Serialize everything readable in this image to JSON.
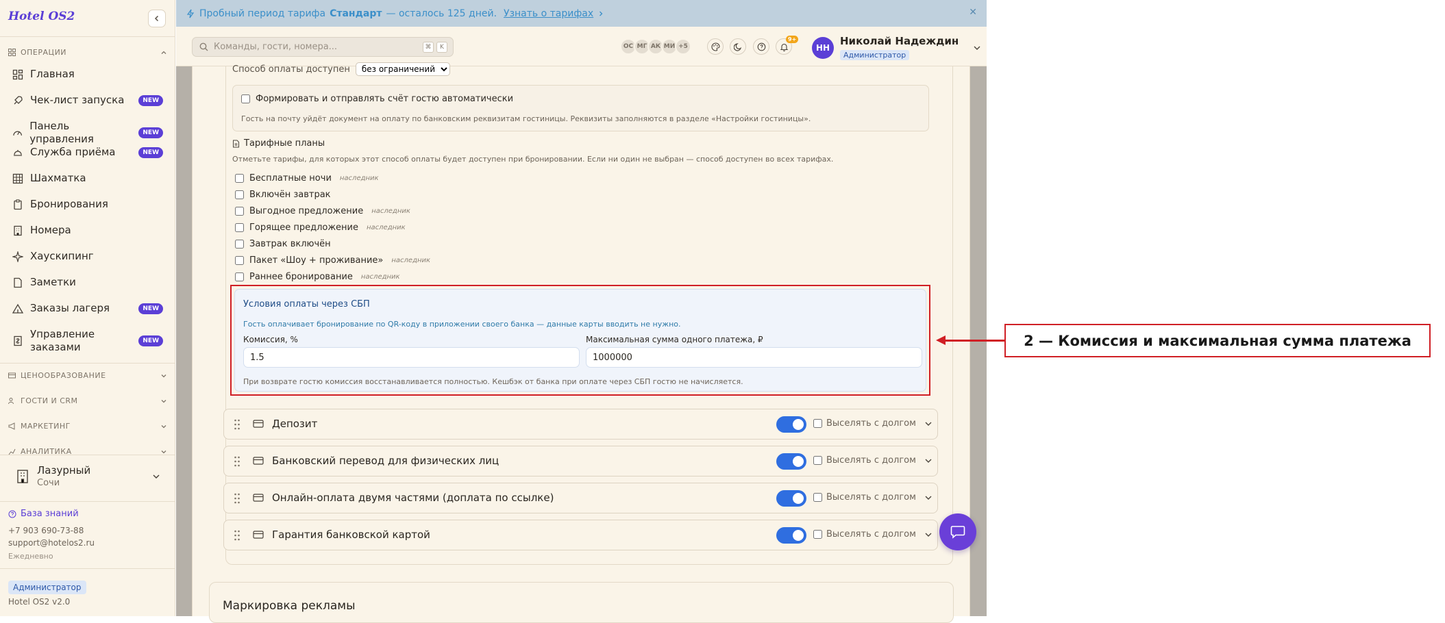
{
  "app": {
    "logo": "Hotel OS2"
  },
  "banner": {
    "prefix": "Пробный период тарифа",
    "plan": "Стандарт",
    "suffix": "— осталось 125 дней.",
    "link": "Узнать о тарифах"
  },
  "sidebar": {
    "operations_title": "ОПЕРАЦИИ",
    "items": [
      {
        "label": "Главная",
        "icon": "dashboard-icon",
        "badge": ""
      },
      {
        "label": "Чек-лист запуска",
        "icon": "rocket-icon",
        "badge": "NEW"
      },
      {
        "label": "Панель управления",
        "icon": "gauge-icon",
        "badge": "NEW"
      },
      {
        "label": "Служба приёма",
        "icon": "bell-desk-icon",
        "badge": "NEW"
      },
      {
        "label": "Шахматка",
        "icon": "grid-icon",
        "badge": ""
      },
      {
        "label": "Бронирования",
        "icon": "clipboard-icon",
        "badge": ""
      },
      {
        "label": "Номера",
        "icon": "building-icon",
        "badge": ""
      },
      {
        "label": "Хаускипинг",
        "icon": "sparkle-icon",
        "badge": ""
      },
      {
        "label": "Заметки",
        "icon": "note-icon",
        "badge": ""
      },
      {
        "label": "Заказы лагеря",
        "icon": "tent-icon",
        "badge": "NEW"
      },
      {
        "label": "Управление заказами",
        "icon": "receipt-icon",
        "badge": "NEW"
      }
    ],
    "sections": [
      "ЦЕНООБРАЗОВАНИЕ",
      "ГОСТИ И CRM",
      "МАРКЕТИНГ",
      "АНАЛИТИКА"
    ],
    "hotel": {
      "name": "Лазурный",
      "city": "Сочи"
    },
    "knowledge": "База знаний",
    "phone": "+7 903 690-73-88",
    "email": "support@hotelos2.ru",
    "hours": "Ежедневно",
    "role": "Администратор",
    "version": "Hotel OS2 v2.0"
  },
  "topbar": {
    "search_placeholder": "Команды, гости, номера...",
    "kbd1": "⌘",
    "kbd2": "K",
    "avatars": [
      "ОС",
      "МГ",
      "АК",
      "МИ",
      "+5"
    ],
    "notif_count": "9+",
    "user_initials": "НН",
    "user_name": "Николай Надеждин",
    "user_role": "Администратор"
  },
  "payment": {
    "availability_label": "Способ оплаты доступен",
    "availability_value": "без ограничений",
    "auto_invoice_label": "Формировать и отправлять счёт гостю автоматически",
    "auto_invoice_hint": "Гость на почту уйдёт документ на оплату по банковским реквизитам гостиницы. Реквизиты заполняются в разделе «Настройки гостиницы».",
    "tariffs_title": "Тарифные планы",
    "tariffs_desc": "Отметьте тарифы, для которых этот способ оплаты будет доступен при бронировании. Если ни один не выбран — способ доступен во всех тарифах.",
    "tariffs": [
      {
        "name": "Бесплатные ночи",
        "tag": "наследник"
      },
      {
        "name": "Включён завтрак",
        "tag": ""
      },
      {
        "name": "Выгодное предложение",
        "tag": "наследник"
      },
      {
        "name": "Горящее предложение",
        "tag": "наследник"
      },
      {
        "name": "Завтрак включён",
        "tag": ""
      },
      {
        "name": "Пакет «Шоу + проживание»",
        "tag": "наследник"
      },
      {
        "name": "Раннее бронирование",
        "tag": "наследник"
      }
    ],
    "sbp": {
      "title": "Условия оплаты через СБП",
      "desc": "Гость оплачивает бронирование по QR-коду в приложении своего банка — данные карты вводить не нужно.",
      "commission_label": "Комиссия, %",
      "commission_value": "1.5",
      "max_label": "Максимальная сумма одного платежа, ₽",
      "max_value": "1000000",
      "note": "При возврате гостю комиссия восстанавливается полностью. Кешбэк от банка при оплате через СБП гостю не начисляется."
    },
    "methods": [
      {
        "title": "Депозит",
        "evict": "Выселять с долгом"
      },
      {
        "title": "Банковский перевод для физических лиц",
        "evict": "Выселять с долгом"
      },
      {
        "title": "Онлайн-оплата двумя частями (доплата по ссылке)",
        "evict": "Выселять с долгом"
      },
      {
        "title": "Гарантия банковской картой",
        "evict": "Выселять с долгом"
      }
    ],
    "ad_title": "Маркировка рекламы"
  },
  "callout": {
    "text": "2 — Комиссия и максимальная сумма платежа"
  },
  "colors": {
    "accent": "#5b3fd6",
    "toggle": "#2f6ee0",
    "highlight": "#d01f25"
  }
}
